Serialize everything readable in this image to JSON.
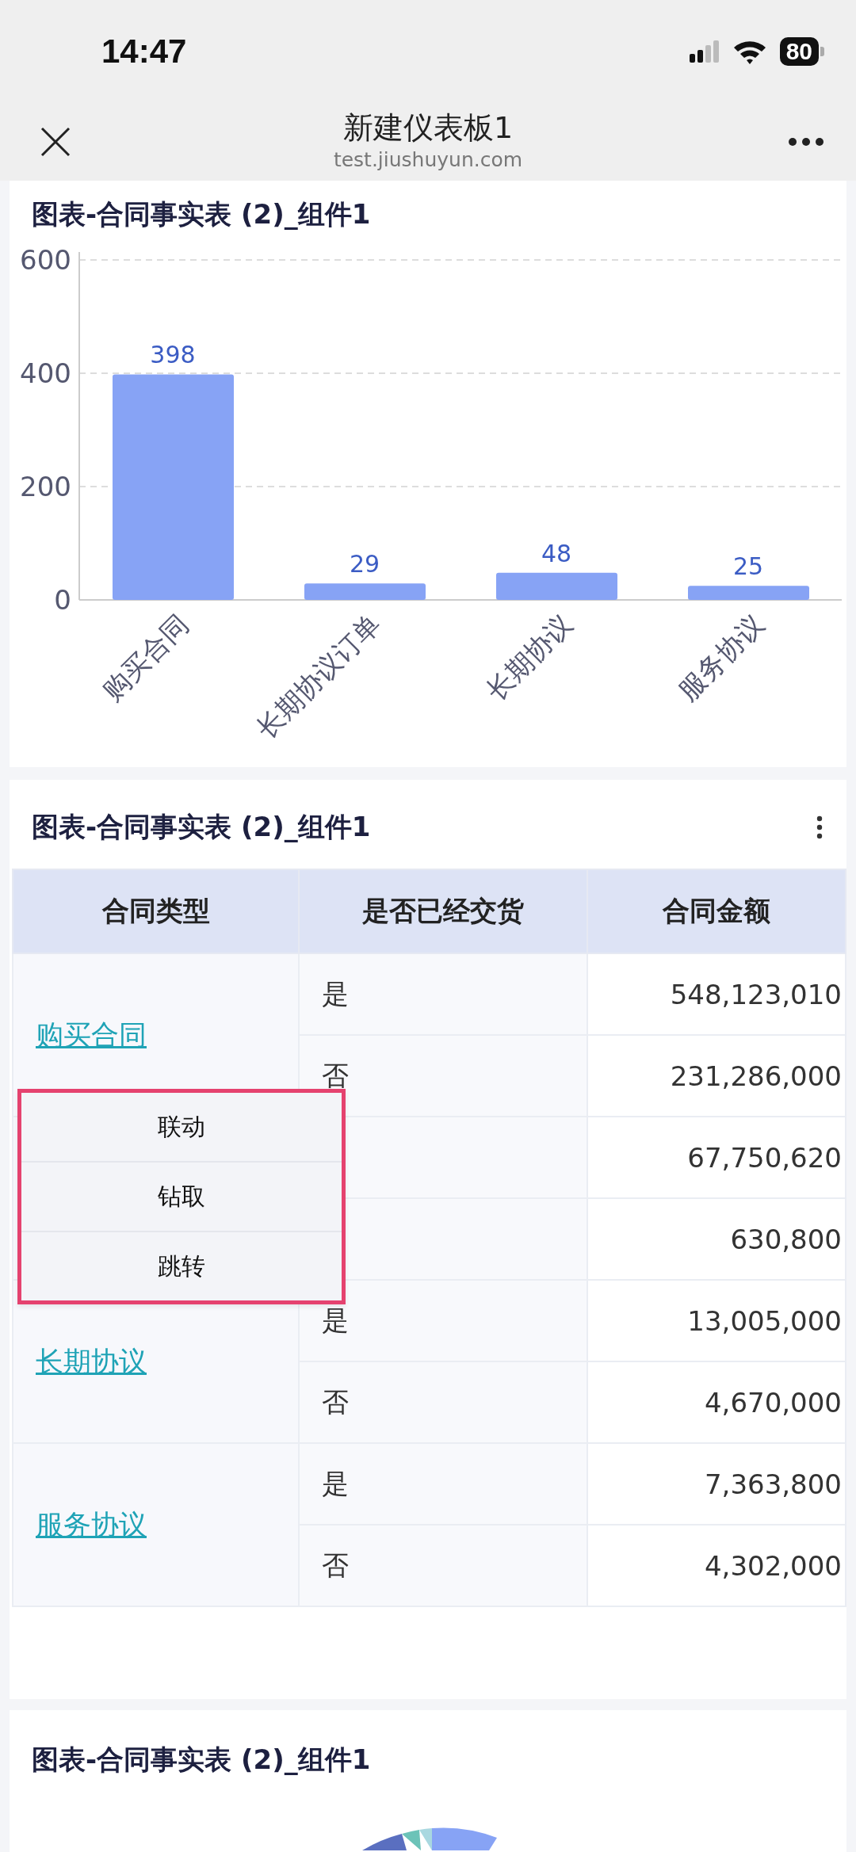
{
  "status_bar": {
    "time": "14:47",
    "battery": "80"
  },
  "nav": {
    "title": "新建仪表板1",
    "subtitle": "test.jiushuyun.com"
  },
  "bar_card": {
    "title": "图表-合同事实表 (2)_组件1",
    "chart_data": {
      "type": "bar",
      "categories": [
        "购买合同",
        "长期协议订单",
        "长期协议",
        "服务协议"
      ],
      "series": [
        {
          "color": "#87a3f5",
          "values": [
            398,
            29,
            48,
            25
          ]
        }
      ],
      "ylim": [
        0,
        600
      ],
      "yticks": [
        0,
        200,
        400,
        600
      ],
      "data_labels": true
    }
  },
  "table_card": {
    "title": "图表-合同事实表 (2)_组件1",
    "columns": [
      "合同类型",
      "是否已经交货",
      "合同金额"
    ],
    "groups": [
      {
        "type": "购买合同",
        "rows": [
          {
            "delivered": "是",
            "amount": "548,123,010"
          },
          {
            "delivered": "否",
            "amount": "231,286,000"
          }
        ]
      },
      {
        "rows": [
          {
            "amount": "67,750,620"
          },
          {
            "amount": "630,800"
          }
        ]
      },
      {
        "type": "长期协议",
        "rows": [
          {
            "delivered": "是",
            "amount": "13,005,000"
          },
          {
            "delivered": "否",
            "amount": "4,670,000"
          }
        ]
      },
      {
        "type": "服务协议",
        "rows": [
          {
            "delivered": "是",
            "amount": "7,363,800"
          },
          {
            "delivered": "否",
            "amount": "4,302,000"
          }
        ]
      }
    ],
    "menu": [
      "联动",
      "钻取",
      "跳转"
    ]
  },
  "pie_card": {
    "title": "图表-合同事实表 (2)_组件1"
  }
}
